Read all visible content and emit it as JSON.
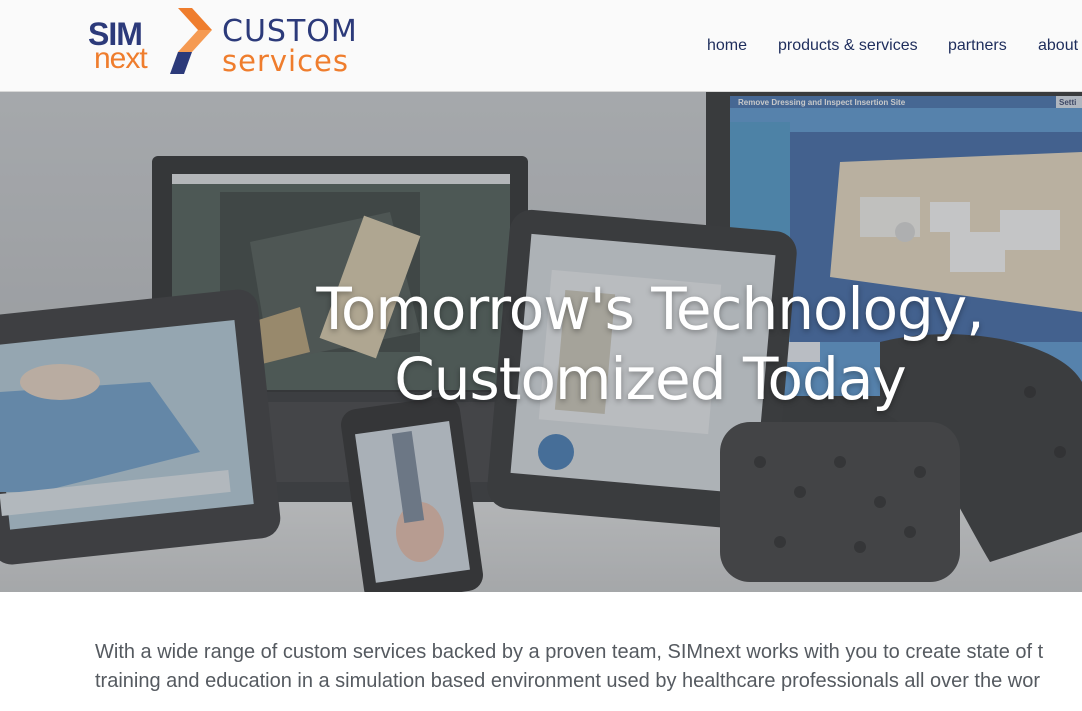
{
  "logo": {
    "sim": "SIM",
    "next": "next",
    "custom": "CUSTOM",
    "services": "services"
  },
  "nav": {
    "items": [
      "home",
      "products & services",
      "partners",
      "about"
    ]
  },
  "hero": {
    "title_line1": "Tomorrow's Technology,",
    "title_line2": "Customized Today",
    "monitor_caption": "Remove Dressing and Inspect Insertion Site",
    "monitor_settings": "Setti",
    "colors": {
      "overlay": "#6b6e72",
      "title": "#ffffff"
    }
  },
  "intro": {
    "line1": "With a wide range of custom services backed by a proven team, SIMnext works with you to create state of t",
    "line2": "training and education in a simulation based environment used by healthcare professionals all over the wor"
  },
  "brand": {
    "navy": "#2c3a7a",
    "orange": "#ef7d2d"
  }
}
